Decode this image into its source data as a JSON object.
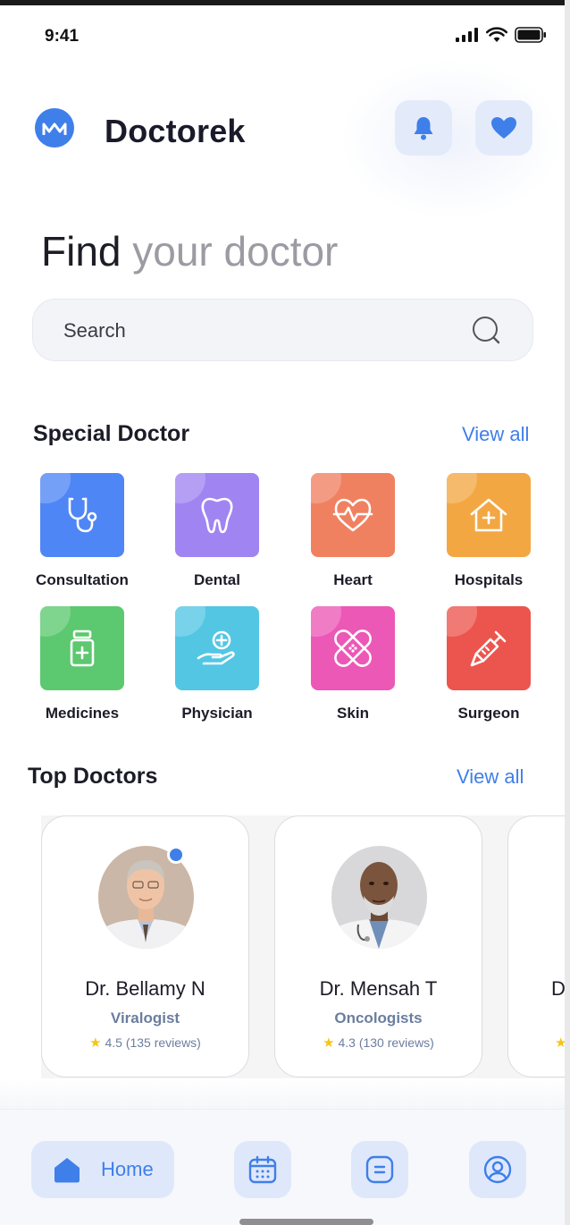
{
  "status_bar": {
    "time": "9:41"
  },
  "header": {
    "app_name": "Doctorek"
  },
  "hero": {
    "title_dark": "Find",
    "title_light": "your doctor"
  },
  "search": {
    "placeholder": "Search"
  },
  "special_doctor": {
    "title": "Special Doctor",
    "view_all": "View all",
    "items": [
      {
        "label": "Consultation",
        "icon": "stethoscope-icon",
        "color": "#4f86f5"
      },
      {
        "label": "Dental",
        "icon": "tooth-icon",
        "color": "#a084f2"
      },
      {
        "label": "Heart",
        "icon": "heartbeat-icon",
        "color": "#f08160"
      },
      {
        "label": "Hospitals",
        "icon": "hospital-house-icon",
        "color": "#f3a742"
      },
      {
        "label": "Medicines",
        "icon": "medicine-bottle-icon",
        "color": "#5cc86f"
      },
      {
        "label": "Physician",
        "icon": "helping-hand-icon",
        "color": "#53c6e4"
      },
      {
        "label": "Skin",
        "icon": "bandage-icon",
        "color": "#ec58b6"
      },
      {
        "label": "Surgeon",
        "icon": "syringe-icon",
        "color": "#ec554e"
      }
    ]
  },
  "top_doctors": {
    "title": "Top Doctors",
    "view_all": "View all",
    "doctors": [
      {
        "name": "Dr. Bellamy N",
        "specialty": "Viralogist",
        "rating": "4.5 (135 reviews)",
        "online": true
      },
      {
        "name": "Dr. Mensah T",
        "specialty": "Oncologists",
        "rating": "4.3 (130 reviews)",
        "online": false
      },
      {
        "name": "D",
        "specialty": "",
        "rating": "",
        "online": false
      }
    ]
  },
  "bottom_nav": {
    "home_label": "Home",
    "active": "home"
  }
}
